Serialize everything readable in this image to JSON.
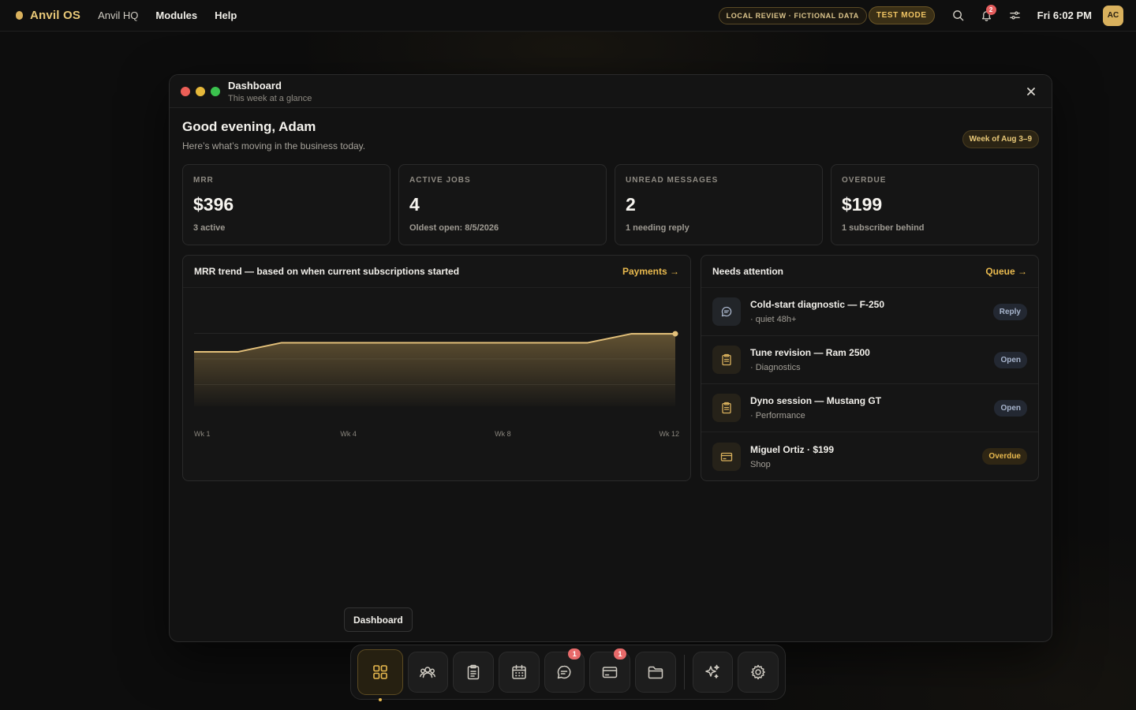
{
  "topbar": {
    "brand": "Anvil OS",
    "nav": [
      "Anvil HQ",
      "Modules",
      "Help"
    ],
    "pill_local": "LOCAL REVIEW · FICTIONAL DATA",
    "pill_test": "TEST MODE",
    "notification_count": "2",
    "clock": "Fri 6:02 PM",
    "avatar_initials": "AC"
  },
  "window": {
    "title": "Dashboard",
    "subtitle": "This week at a glance",
    "close_label": "✕"
  },
  "dashboard": {
    "greeting": "Good evening, Adam",
    "greeting_sub": "Here’s what’s moving in the business today.",
    "week_label": "Week of Aug 3–9",
    "stats": [
      {
        "label": "MRR",
        "value": "$396",
        "note": "3 active"
      },
      {
        "label": "ACTIVE JOBS",
        "value": "4",
        "note": "Oldest open: 8/5/2026"
      },
      {
        "label": "UNREAD MESSAGES",
        "value": "2",
        "note": "1 needing reply"
      },
      {
        "label": "OVERDUE",
        "value": "$199",
        "note": "1 subscriber behind"
      }
    ],
    "trend": {
      "title": "MRR trend — based on when current subscriptions started",
      "link": "Payments →"
    },
    "attention": {
      "title": "Needs attention",
      "link": "Queue →",
      "items": [
        {
          "title": "Cold-start diagnostic — F-250",
          "sub": "· quiet 48h+",
          "tag": "Reply",
          "icon": "chat-icon"
        },
        {
          "title": "Tune revision — Ram 2500",
          "sub": "· Diagnostics",
          "tag": "Open",
          "icon": "clipboard-icon"
        },
        {
          "title": "Dyno session — Mustang GT",
          "sub": "· Performance",
          "tag": "Open",
          "icon": "clipboard-icon"
        },
        {
          "title": "Miguel Ortiz · $199",
          "sub": "Shop",
          "tag": "Overdue",
          "icon": "card-icon"
        }
      ]
    }
  },
  "chart_data": {
    "type": "area",
    "x": [
      1,
      2,
      3,
      4,
      5,
      6,
      7,
      8,
      9,
      10,
      11,
      12
    ],
    "tick_labels": [
      "Wk 1",
      "Wk 4",
      "Wk 8",
      "Wk 12"
    ],
    "tick_positions": [
      1,
      4.5,
      8,
      11.5
    ],
    "series": [
      {
        "values": [
          297,
          297,
          347,
          347,
          347,
          347,
          347,
          347,
          347,
          347,
          396,
          396
        ]
      }
    ],
    "ylim": [
      0,
      560
    ],
    "grid": true,
    "line_color": "#e3c07a"
  },
  "tooltip": "Dashboard",
  "dock": {
    "items": [
      {
        "name": "dashboard",
        "icon": "grid-icon",
        "active": true,
        "badge": ""
      },
      {
        "name": "people",
        "icon": "people-icon",
        "active": false,
        "badge": ""
      },
      {
        "name": "jobs",
        "icon": "clipboard-icon",
        "active": false,
        "badge": ""
      },
      {
        "name": "calendar",
        "icon": "calendar-icon",
        "active": false,
        "badge": ""
      },
      {
        "name": "messages",
        "icon": "chat-icon",
        "active": false,
        "badge": "1"
      },
      {
        "name": "payments",
        "icon": "card-icon",
        "active": false,
        "badge": "1"
      },
      {
        "name": "files",
        "icon": "folder-icon",
        "active": false,
        "badge": ""
      },
      {
        "name": "assistant",
        "icon": "sparkle-icon",
        "active": false,
        "badge": ""
      },
      {
        "name": "settings",
        "icon": "gear-icon",
        "active": false,
        "badge": ""
      }
    ]
  }
}
